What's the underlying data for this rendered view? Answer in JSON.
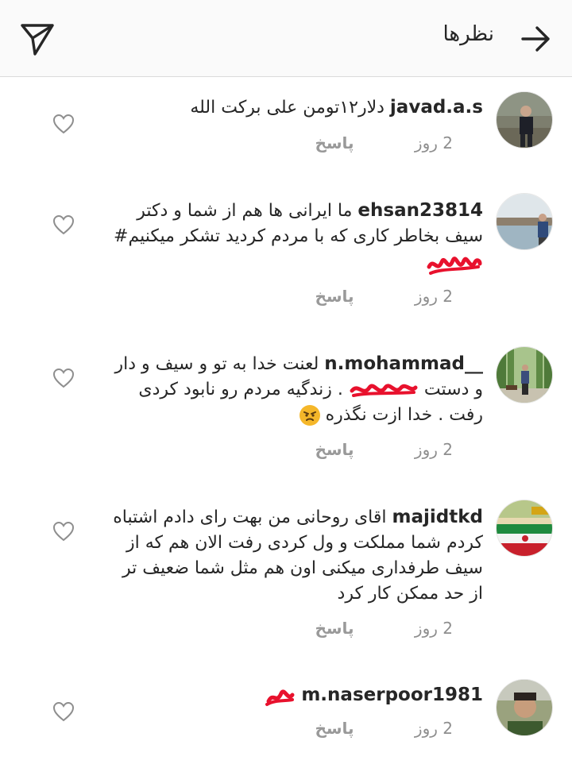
{
  "header": {
    "title": "نظرها",
    "back_icon": "arrow-right-icon",
    "send_icon": "paper-plane-icon"
  },
  "comments": [
    {
      "username": "javad.a.s",
      "text": "دلار۱۲تومن علی برکت الله",
      "time": "2 روز",
      "reply": "پاسخ"
    },
    {
      "username": "ehsan23814",
      "text": "ما ایرانی ها هم از شما و دکتر سیف بخاطر کاری که با مردم کردید تشکر میکنیم#",
      "time": "2 روز",
      "reply": "پاسخ"
    },
    {
      "username": "n.mohammad__",
      "text_before": "لعنت خدا به تو و سیف و دار و دستت",
      "text_after": ". زندگیه مردم رو نابود کردی رفت . خدا ازت نگذره",
      "time": "2 روز",
      "reply": "پاسخ"
    },
    {
      "username": "majidtkd",
      "text": "اقای روحانی من بهت رای دادم اشتباه کردم شما مملکت و ول کردی رفت الان هم که از سیف طرفداری میکنی اون هم مثل شما ضعیف تر از حد ممکن کار کرد",
      "time": "2 روز",
      "reply": "پاسخ"
    },
    {
      "username": "m.naserpoor1981",
      "text": "",
      "time": "2 روز",
      "reply": "پاسخ"
    }
  ],
  "colors": {
    "header_bg": "#fafafa",
    "text": "#262626",
    "meta": "#8e8e8e",
    "scribble": "#e8112d"
  }
}
